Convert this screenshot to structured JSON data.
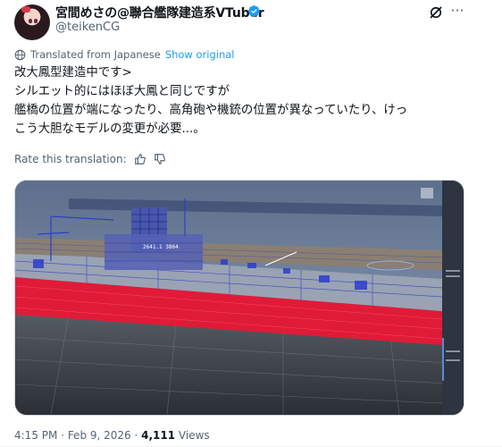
{
  "author": {
    "display_name": "宮間めさの@聯合艦隊建造系VTuber",
    "handle": "@teikenCG"
  },
  "translation": {
    "notice": "Translated from Japanese",
    "show_original": "Show original",
    "rate_label": "Rate this translation:"
  },
  "tweet": {
    "lines": [
      "改大鳳型建造中です>",
      "シルエット的にはほぼ大鳳と同じですが",
      "艦橋の位置が端になったり、高角砲や機銃の位置が異なっていたり、けっ",
      "こう大胆なモデルの変更が必要...。"
    ]
  },
  "media": {
    "overlay_text": "2641.1 3864",
    "description_icons": [
      "ship-render"
    ]
  },
  "meta": {
    "time": "4:15 PM",
    "sep1": " · ",
    "date": "Feb 9, 2026",
    "sep2": " · ",
    "views_count": "4,111",
    "views_label": " Views"
  },
  "colors": {
    "accent": "#1d9bf0",
    "text": "#0f1419",
    "muted": "#536471"
  },
  "icons": [
    "verified-badge-icon",
    "grok-icon",
    "more-icon",
    "globe-icon",
    "thumbs-up-icon",
    "thumbs-down-icon"
  ]
}
